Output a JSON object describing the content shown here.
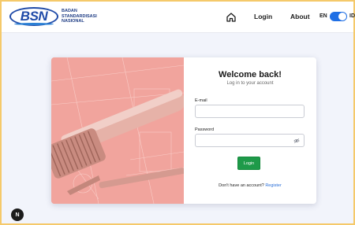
{
  "header": {
    "logo_text": "BSN",
    "logo_subtitle_lines": [
      "BADAN",
      "STANDARDISASI",
      "NASIONAL"
    ],
    "home_icon": "home-icon",
    "nav": {
      "login": "Login",
      "about": "About"
    },
    "lang": {
      "left": "EN",
      "right": "ID",
      "toggle_on": true
    }
  },
  "card": {
    "title": "Welcome back!",
    "subtitle": "Log in to your account",
    "email_label": "E-mail",
    "email_value": "",
    "password_label": "Password",
    "password_value": "",
    "eye_icon": "eye-off-icon",
    "login_button": "Login",
    "register_prompt": "Don't have an account?",
    "register_link": "Register"
  },
  "floating_badge": "N",
  "colors": {
    "brand_blue": "#1f4aa8",
    "toggle_blue": "#1f6fe5",
    "login_green": "#1e9a49",
    "link_blue": "#2a6fd8",
    "art_tint": "#f1a49d",
    "frame": "#f5c96a"
  }
}
